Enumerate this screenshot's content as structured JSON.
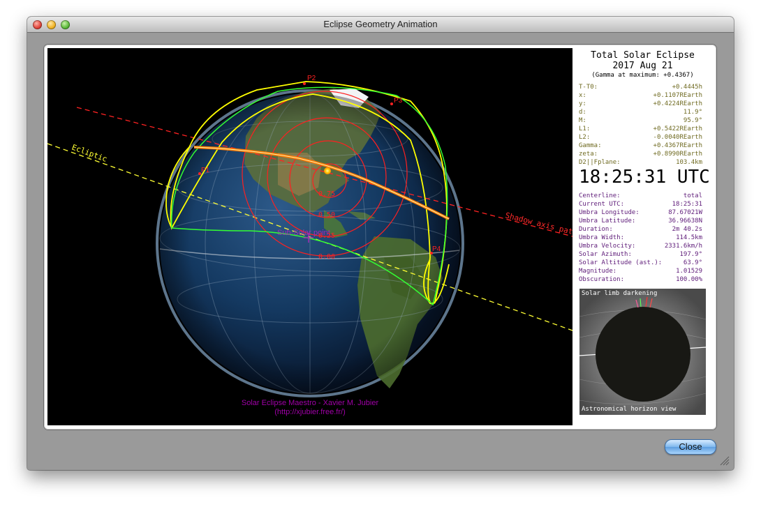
{
  "window": {
    "title": "Eclipse Geometry Animation"
  },
  "scene": {
    "ecliptic_label": "Ecliptic",
    "shadow_axis_label": "Shadow axis path",
    "subsolar_label": "Sub-Solar point",
    "point_labels": [
      "P1",
      "P2",
      "P3",
      "P4"
    ],
    "contour_labels": [
      "0.75",
      "0.50",
      "0.25",
      "0.00"
    ],
    "credit_line1": "Solar Eclipse Maestro - Xavier M. Jubier",
    "credit_line2": "(http://xjubier.free.fr/)",
    "colors": {
      "ecliptic": "#ffff33",
      "shadow_axis": "#ff2222",
      "penumbra": "#ffff00",
      "rise_set": "#33ff33",
      "contour": "#ff2020",
      "subsolar": "#a22bb5"
    }
  },
  "panel": {
    "title": "Total Solar Eclipse",
    "date": "2017 Aug 21",
    "gamma_note": "(Gamma at maximum: +0.4367)",
    "geometry": [
      {
        "key": "T-T0:",
        "value": "+0.4445h"
      },
      {
        "key": "x:",
        "value": "+0.1107REarth"
      },
      {
        "key": "y:",
        "value": "+0.4224REarth"
      },
      {
        "key": "d:",
        "value": "11.9°"
      },
      {
        "key": "M:",
        "value": "95.9°"
      },
      {
        "key": "L1:",
        "value": "+0.5422REarth"
      },
      {
        "key": "L2:",
        "value": "-0.0040REarth"
      },
      {
        "key": "Gamma:",
        "value": "+0.4367REarth"
      },
      {
        "key": "zeta:",
        "value": "+0.8990REarth"
      },
      {
        "key": "D2||Fplane:",
        "value": "103.4km"
      }
    ],
    "time": "18:25:31 UTC",
    "circumstances": [
      {
        "key": "Centerline:",
        "value": "total"
      },
      {
        "key": "Current UTC:",
        "value": "18:25:31"
      },
      {
        "key": "Umbra Longitude:",
        "value": "87.67021W"
      },
      {
        "key": "Umbra Latitude:",
        "value": "36.96638N"
      },
      {
        "key": "Duration:",
        "value": "2m 40.2s"
      },
      {
        "key": "Umbra Width:",
        "value": "114.5km"
      },
      {
        "key": "Umbra Velocity:",
        "value": "2331.6km/h"
      },
      {
        "key": "Solar Azimuth:",
        "value": "197.9°"
      },
      {
        "key": "Solar Altitude (ast.):",
        "value": "63.9°"
      },
      {
        "key": "Magnitude:",
        "value": "1.01529"
      },
      {
        "key": "Obscuration:",
        "value": "100.00%"
      }
    ],
    "sun_view_title": "Solar limb darkening",
    "sun_view_caption": "Astronomical horizon view"
  },
  "buttons": {
    "close": "Close"
  }
}
